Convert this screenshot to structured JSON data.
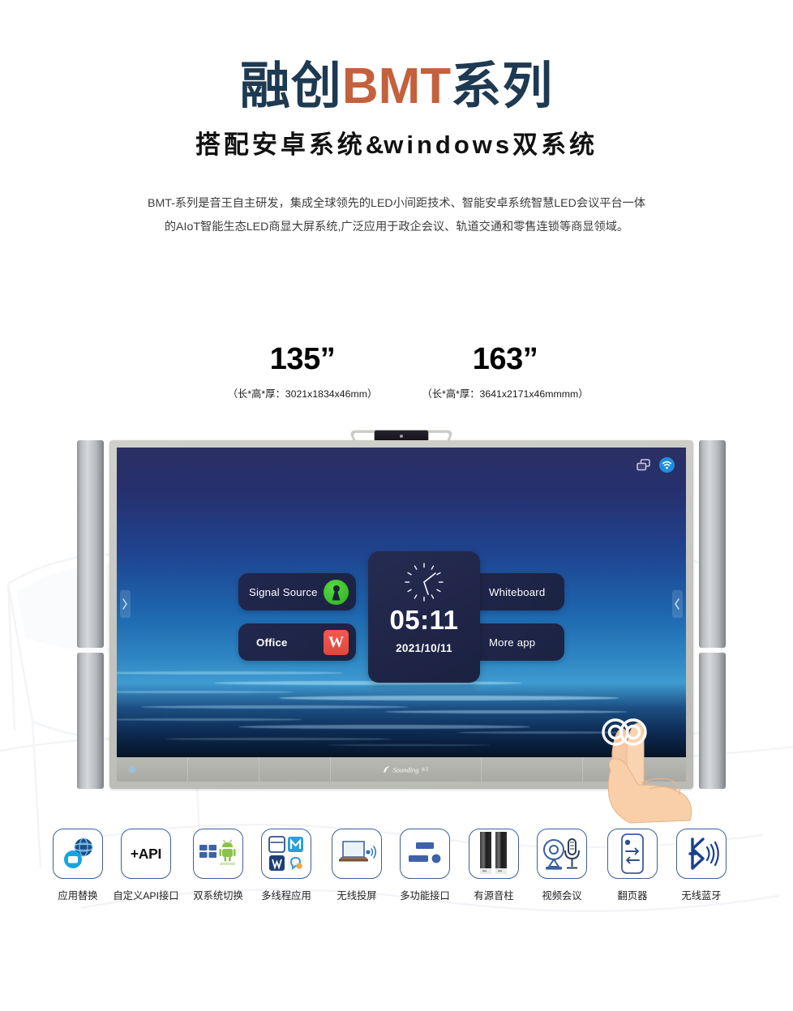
{
  "header": {
    "title_part1": "融创",
    "title_accent": "BMT",
    "title_part2": "系列",
    "subtitle_part1": "搭配安卓系统",
    "subtitle_amp": "&",
    "subtitle_part2": "windows双系统",
    "description_line1": "BMT-系列是音王自主研发，集成全球领先的LED小间距技术、智能安卓系统智慧LED会议平台一体",
    "description_line2": "的AIoT智能生态LED商显大屏系统,广泛应用于政企会议、轨道交通和零售连锁等商显领域。"
  },
  "colors": {
    "accent_orange": "#c4603c",
    "title_navy": "#1e3a52",
    "icon_border_blue": "#3f5f99",
    "wifi_blue": "#1d8fe0",
    "signal_green": "#2fb01e",
    "wps_red": "#e2473d"
  },
  "sizes": [
    {
      "inches": "135”",
      "dimensions": "（长*高*厚：3021x1834x46mm）"
    },
    {
      "inches": "163”",
      "dimensions": "（长*高*厚：3641x2171x46mmmm）"
    }
  ],
  "device": {
    "camera_icon": "camera-bar-icon",
    "status_icons": [
      {
        "name": "screen-cast-icon"
      },
      {
        "name": "wifi-icon"
      }
    ],
    "brand_logo": "Sounding",
    "brand_logo_cn": "音王",
    "side_handle_icon": "chevron-icon",
    "touch_gesture_icon": "two-finger-touch-icon",
    "launcher": {
      "tiles": [
        {
          "label": "Signal Source",
          "icon": "signal-source-icon"
        },
        {
          "label": "Office",
          "icon": "wps-office-icon"
        },
        {
          "label": "Whiteboard",
          "icon": "whiteboard-icon"
        },
        {
          "label": "More app",
          "icon": "app-grid-icon"
        }
      ],
      "clock": {
        "time": "05:11",
        "date": "2021/10/11",
        "analog_icon": "analog-clock-icon"
      }
    }
  },
  "features": [
    {
      "label": "应用替换",
      "icon": "app-replace-icon"
    },
    {
      "label": "自定义API接口",
      "icon": "api-icon",
      "text": "+API"
    },
    {
      "label": "双系统切换",
      "icon": "dual-system-icon"
    },
    {
      "label": "多线程应用",
      "icon": "multithread-apps-icon"
    },
    {
      "label": "无线投屏",
      "icon": "wireless-cast-icon"
    },
    {
      "label": "多功能接口",
      "icon": "multi-port-icon"
    },
    {
      "label": "有源音柱",
      "icon": "speaker-column-icon"
    },
    {
      "label": "视频会议",
      "icon": "video-conference-icon"
    },
    {
      "label": "翻页器",
      "icon": "page-turner-icon"
    },
    {
      "label": "无线蓝牙",
      "icon": "bluetooth-icon"
    }
  ]
}
